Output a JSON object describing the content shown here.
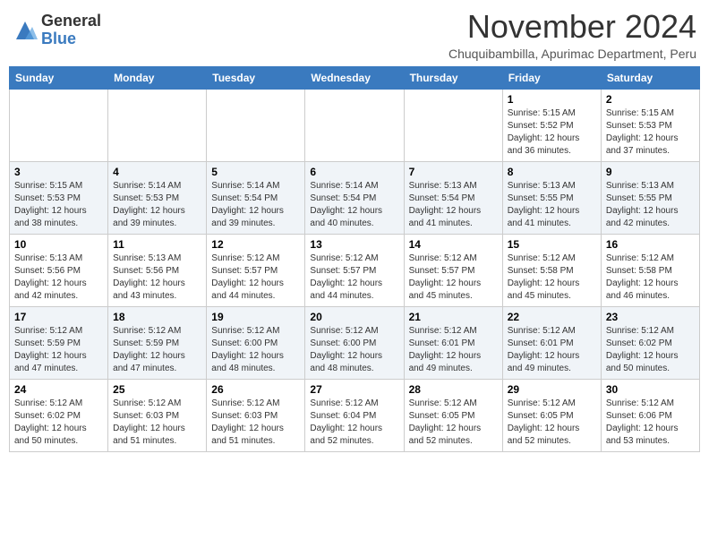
{
  "header": {
    "logo_line1": "General",
    "logo_line2": "Blue",
    "month_year": "November 2024",
    "location": "Chuquibambilla, Apurimac Department, Peru"
  },
  "weekdays": [
    "Sunday",
    "Monday",
    "Tuesday",
    "Wednesday",
    "Thursday",
    "Friday",
    "Saturday"
  ],
  "weeks": [
    [
      {
        "day": "",
        "info": ""
      },
      {
        "day": "",
        "info": ""
      },
      {
        "day": "",
        "info": ""
      },
      {
        "day": "",
        "info": ""
      },
      {
        "day": "",
        "info": ""
      },
      {
        "day": "1",
        "info": "Sunrise: 5:15 AM\nSunset: 5:52 PM\nDaylight: 12 hours\nand 36 minutes."
      },
      {
        "day": "2",
        "info": "Sunrise: 5:15 AM\nSunset: 5:53 PM\nDaylight: 12 hours\nand 37 minutes."
      }
    ],
    [
      {
        "day": "3",
        "info": "Sunrise: 5:15 AM\nSunset: 5:53 PM\nDaylight: 12 hours\nand 38 minutes."
      },
      {
        "day": "4",
        "info": "Sunrise: 5:14 AM\nSunset: 5:53 PM\nDaylight: 12 hours\nand 39 minutes."
      },
      {
        "day": "5",
        "info": "Sunrise: 5:14 AM\nSunset: 5:54 PM\nDaylight: 12 hours\nand 39 minutes."
      },
      {
        "day": "6",
        "info": "Sunrise: 5:14 AM\nSunset: 5:54 PM\nDaylight: 12 hours\nand 40 minutes."
      },
      {
        "day": "7",
        "info": "Sunrise: 5:13 AM\nSunset: 5:54 PM\nDaylight: 12 hours\nand 41 minutes."
      },
      {
        "day": "8",
        "info": "Sunrise: 5:13 AM\nSunset: 5:55 PM\nDaylight: 12 hours\nand 41 minutes."
      },
      {
        "day": "9",
        "info": "Sunrise: 5:13 AM\nSunset: 5:55 PM\nDaylight: 12 hours\nand 42 minutes."
      }
    ],
    [
      {
        "day": "10",
        "info": "Sunrise: 5:13 AM\nSunset: 5:56 PM\nDaylight: 12 hours\nand 42 minutes."
      },
      {
        "day": "11",
        "info": "Sunrise: 5:13 AM\nSunset: 5:56 PM\nDaylight: 12 hours\nand 43 minutes."
      },
      {
        "day": "12",
        "info": "Sunrise: 5:12 AM\nSunset: 5:57 PM\nDaylight: 12 hours\nand 44 minutes."
      },
      {
        "day": "13",
        "info": "Sunrise: 5:12 AM\nSunset: 5:57 PM\nDaylight: 12 hours\nand 44 minutes."
      },
      {
        "day": "14",
        "info": "Sunrise: 5:12 AM\nSunset: 5:57 PM\nDaylight: 12 hours\nand 45 minutes."
      },
      {
        "day": "15",
        "info": "Sunrise: 5:12 AM\nSunset: 5:58 PM\nDaylight: 12 hours\nand 45 minutes."
      },
      {
        "day": "16",
        "info": "Sunrise: 5:12 AM\nSunset: 5:58 PM\nDaylight: 12 hours\nand 46 minutes."
      }
    ],
    [
      {
        "day": "17",
        "info": "Sunrise: 5:12 AM\nSunset: 5:59 PM\nDaylight: 12 hours\nand 47 minutes."
      },
      {
        "day": "18",
        "info": "Sunrise: 5:12 AM\nSunset: 5:59 PM\nDaylight: 12 hours\nand 47 minutes."
      },
      {
        "day": "19",
        "info": "Sunrise: 5:12 AM\nSunset: 6:00 PM\nDaylight: 12 hours\nand 48 minutes."
      },
      {
        "day": "20",
        "info": "Sunrise: 5:12 AM\nSunset: 6:00 PM\nDaylight: 12 hours\nand 48 minutes."
      },
      {
        "day": "21",
        "info": "Sunrise: 5:12 AM\nSunset: 6:01 PM\nDaylight: 12 hours\nand 49 minutes."
      },
      {
        "day": "22",
        "info": "Sunrise: 5:12 AM\nSunset: 6:01 PM\nDaylight: 12 hours\nand 49 minutes."
      },
      {
        "day": "23",
        "info": "Sunrise: 5:12 AM\nSunset: 6:02 PM\nDaylight: 12 hours\nand 50 minutes."
      }
    ],
    [
      {
        "day": "24",
        "info": "Sunrise: 5:12 AM\nSunset: 6:02 PM\nDaylight: 12 hours\nand 50 minutes."
      },
      {
        "day": "25",
        "info": "Sunrise: 5:12 AM\nSunset: 6:03 PM\nDaylight: 12 hours\nand 51 minutes."
      },
      {
        "day": "26",
        "info": "Sunrise: 5:12 AM\nSunset: 6:03 PM\nDaylight: 12 hours\nand 51 minutes."
      },
      {
        "day": "27",
        "info": "Sunrise: 5:12 AM\nSunset: 6:04 PM\nDaylight: 12 hours\nand 52 minutes."
      },
      {
        "day": "28",
        "info": "Sunrise: 5:12 AM\nSunset: 6:05 PM\nDaylight: 12 hours\nand 52 minutes."
      },
      {
        "day": "29",
        "info": "Sunrise: 5:12 AM\nSunset: 6:05 PM\nDaylight: 12 hours\nand 52 minutes."
      },
      {
        "day": "30",
        "info": "Sunrise: 5:12 AM\nSunset: 6:06 PM\nDaylight: 12 hours\nand 53 minutes."
      }
    ]
  ]
}
